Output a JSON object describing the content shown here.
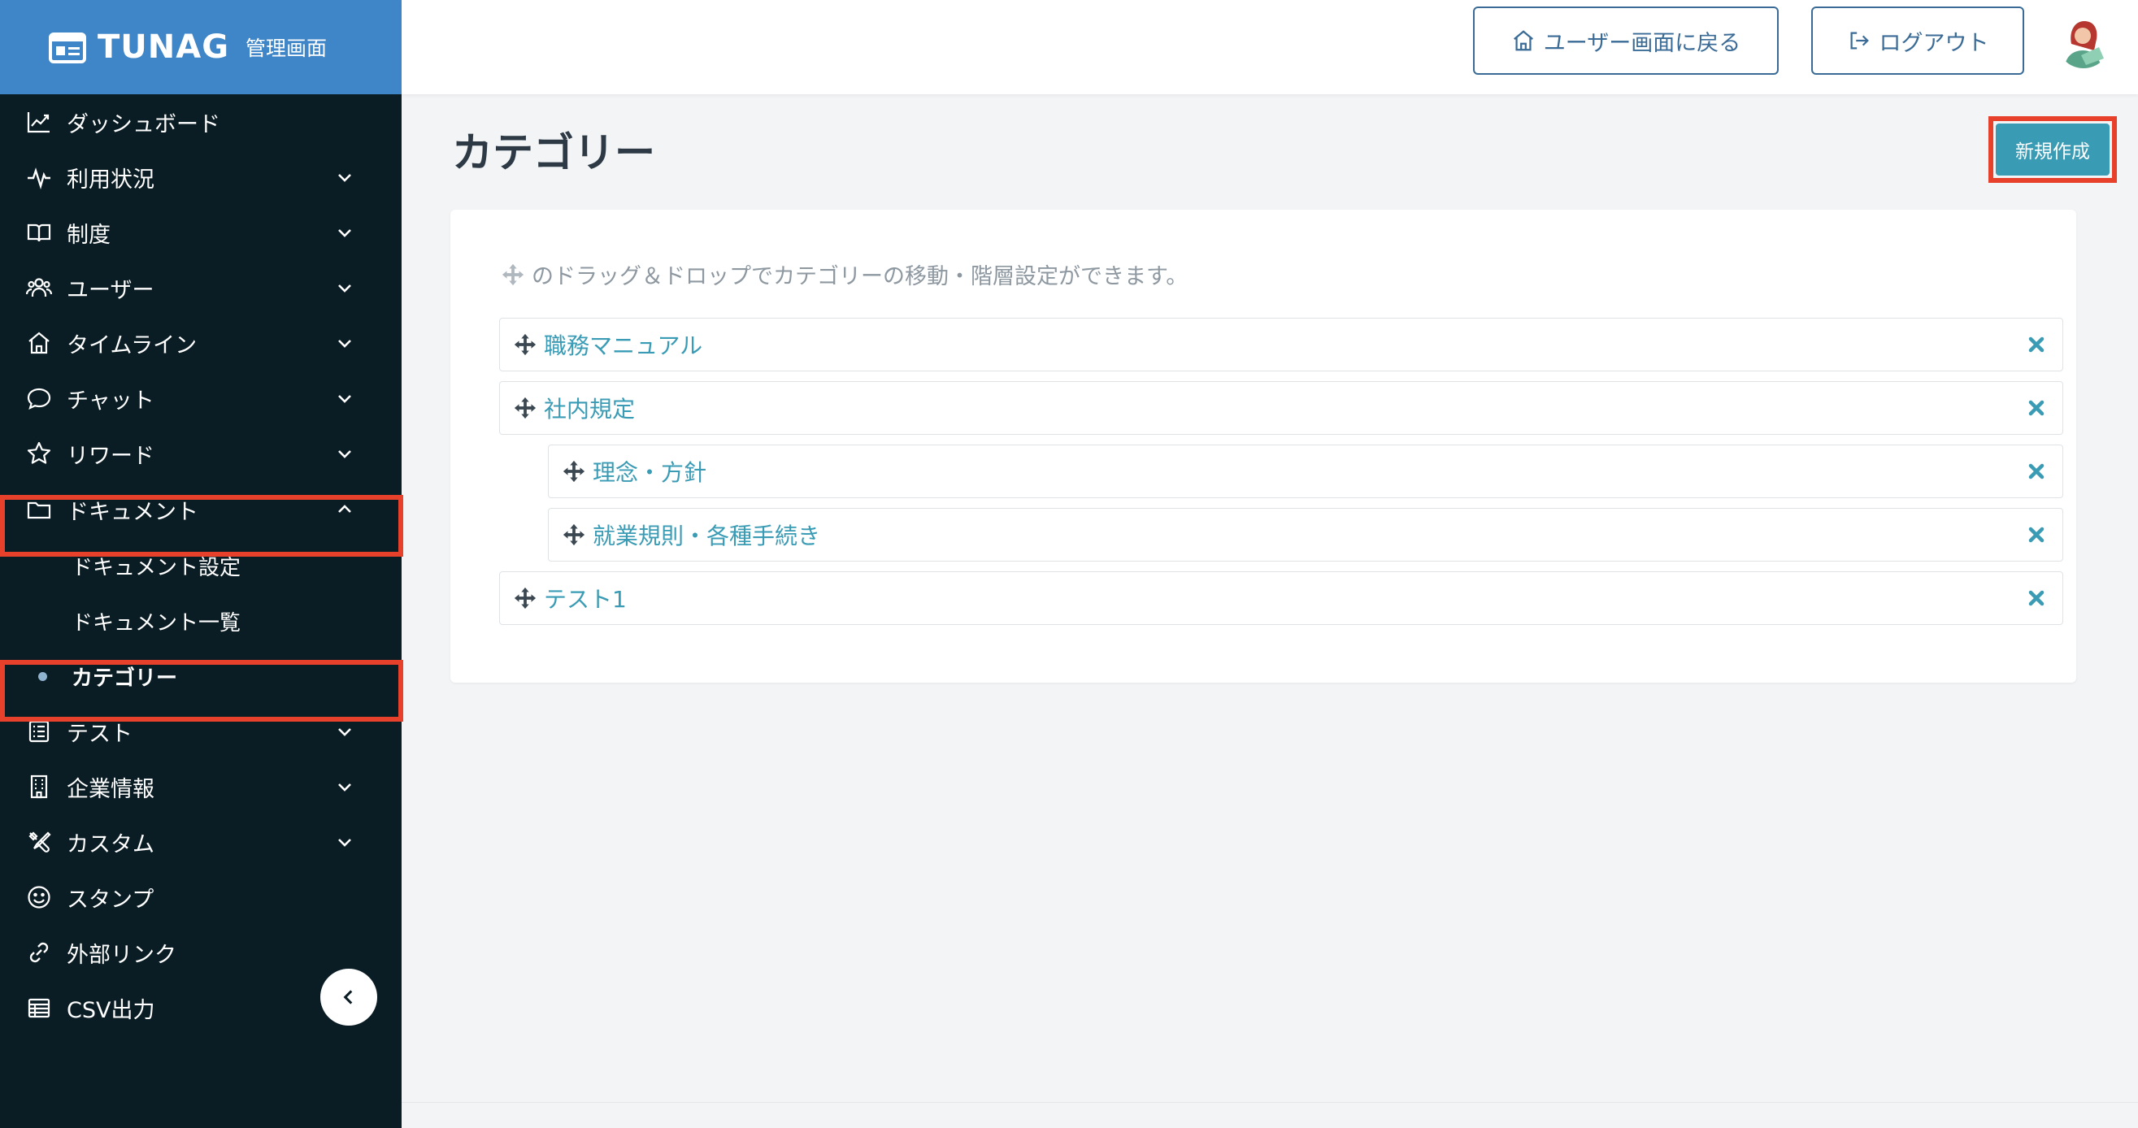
{
  "brand": {
    "name": "TUNAG",
    "subtitle": "管理画面"
  },
  "sidebar": {
    "items": [
      {
        "label": "ダッシュボード",
        "icon": "chart-line-icon"
      },
      {
        "label": "利用状況",
        "icon": "activity-icon",
        "expandable": true
      },
      {
        "label": "制度",
        "icon": "book-open-icon",
        "expandable": true
      },
      {
        "label": "ユーザー",
        "icon": "users-icon",
        "expandable": true
      },
      {
        "label": "タイムライン",
        "icon": "home-icon",
        "expandable": true
      },
      {
        "label": "チャット",
        "icon": "chat-bubble-icon",
        "expandable": true
      },
      {
        "label": "リワード",
        "icon": "star-icon",
        "expandable": true
      },
      {
        "label": "ドキュメント",
        "icon": "folder-icon",
        "expandable": true,
        "expanded": true
      },
      {
        "label": "テスト",
        "icon": "checklist-icon",
        "expandable": true
      },
      {
        "label": "企業情報",
        "icon": "building-icon",
        "expandable": true
      },
      {
        "label": "カスタム",
        "icon": "tools-icon",
        "expandable": true
      },
      {
        "label": "スタンプ",
        "icon": "smile-icon"
      },
      {
        "label": "外部リンク",
        "icon": "link-icon"
      },
      {
        "label": "CSV出力",
        "icon": "table-icon"
      }
    ],
    "document_subitems": [
      {
        "label": "ドキュメント設定"
      },
      {
        "label": "ドキュメント一覧"
      },
      {
        "label": "カテゴリー",
        "active": true
      }
    ]
  },
  "header": {
    "back_to_user_label": "ユーザー画面に戻る",
    "logout_label": "ログアウト"
  },
  "main": {
    "title": "カテゴリー",
    "new_button_label": "新規作成",
    "hint": "のドラッグ＆ドロップでカテゴリーの移動・階層設定ができます。",
    "categories": [
      {
        "label": "職務マニュアル",
        "level": 0
      },
      {
        "label": "社内規定",
        "level": 0
      },
      {
        "label": "理念・方針",
        "level": 1
      },
      {
        "label": "就業規則・各種手続き",
        "level": 1
      },
      {
        "label": "テスト1",
        "level": 0
      }
    ]
  },
  "colors": {
    "brand_blue": "#3f86c8",
    "sidebar_bg": "#0a1c24",
    "accent_teal": "#3a9bb5",
    "highlight_red": "#e8412b",
    "outline_blue": "#3a6b96"
  }
}
